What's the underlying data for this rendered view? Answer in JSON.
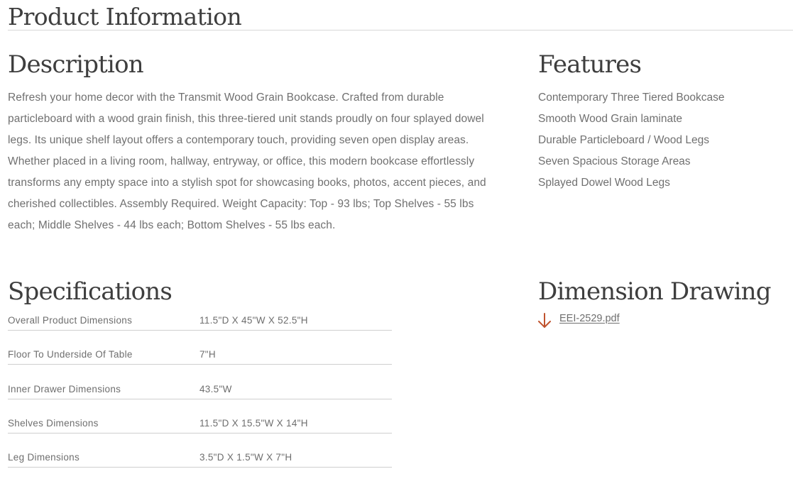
{
  "page": {
    "title": "Product Information"
  },
  "description": {
    "heading": "Description",
    "text": "Refresh your home decor with the Transmit Wood Grain Bookcase. Crafted from durable particleboard with a wood grain finish, this three-tiered unit stands proudly on four splayed dowel legs. Its unique shelf layout offers a contemporary touch, providing seven open display areas. Whether placed in a living room, hallway, entryway, or office, this modern bookcase effortlessly transforms any empty space into a stylish spot for showcasing books, photos, accent pieces, and cherished collectibles. Assembly Required. Weight Capacity: Top - 93 lbs; Top Shelves - 55 lbs each; Middle Shelves - 44 lbs each; Bottom Shelves - 55 lbs each."
  },
  "features": {
    "heading": "Features",
    "items": [
      "Contemporary Three Tiered Bookcase",
      "Smooth Wood Grain laminate",
      "Durable Particleboard / Wood Legs",
      "Seven Spacious Storage Areas",
      "Splayed Dowel Wood Legs"
    ]
  },
  "specifications": {
    "heading": "Specifications",
    "rows": [
      {
        "name": "Overall Product Dimensions",
        "value": "11.5\"D X 45\"W X 52.5\"H"
      },
      {
        "name": "Floor To Underside Of Table",
        "value": "7\"H"
      },
      {
        "name": "Inner Drawer Dimensions",
        "value": "43.5\"W"
      },
      {
        "name": "Shelves Dimensions",
        "value": "11.5\"D X 15.5\"W X 14\"H"
      },
      {
        "name": "Leg Dimensions",
        "value": "3.5\"D X 1.5\"W X 7\"H"
      }
    ]
  },
  "dimension_drawing": {
    "heading": "Dimension Drawing",
    "file_label": "EEI-2529.pdf",
    "icon": "download-arrow-icon",
    "icon_color": "#c0532e"
  }
}
